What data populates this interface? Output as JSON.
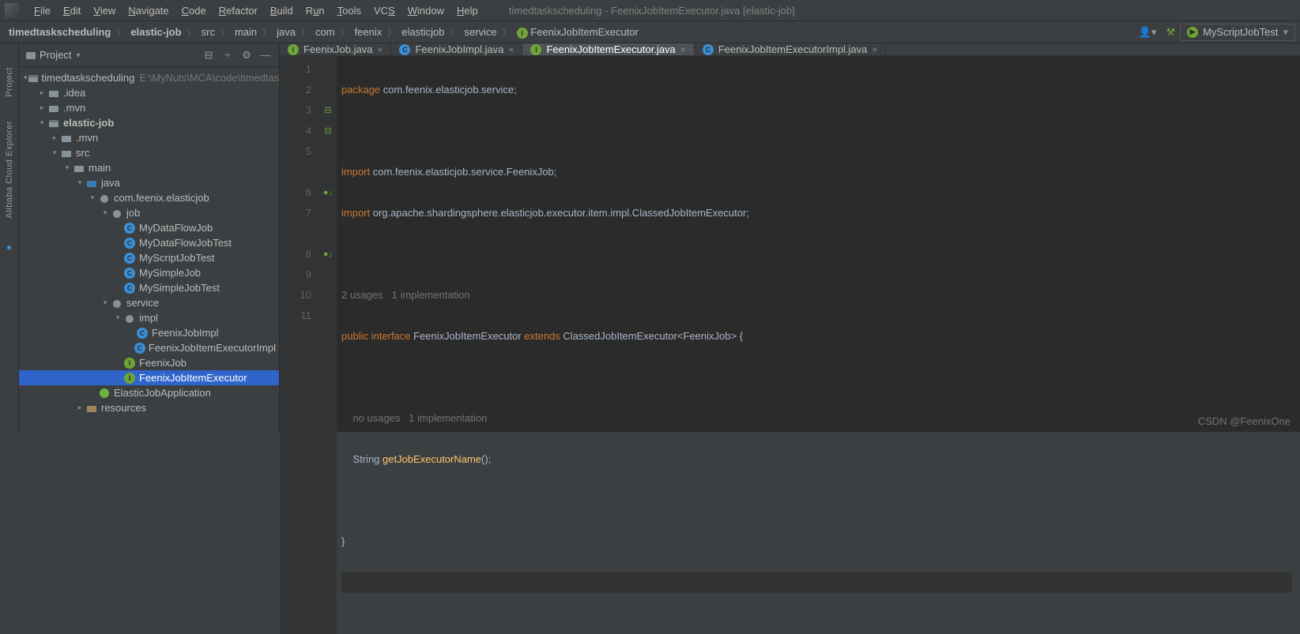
{
  "window": {
    "title": "timedtaskscheduling - FeenixJobItemExecutor.java [elastic-job]"
  },
  "menu": [
    "File",
    "Edit",
    "View",
    "Navigate",
    "Code",
    "Refactor",
    "Build",
    "Run",
    "Tools",
    "VCS",
    "Window",
    "Help"
  ],
  "breadcrumb": [
    {
      "label": "timedtaskscheduling",
      "bold": true
    },
    {
      "label": "elastic-job",
      "bold": true
    },
    {
      "label": "src"
    },
    {
      "label": "main"
    },
    {
      "label": "java"
    },
    {
      "label": "com"
    },
    {
      "label": "feenix"
    },
    {
      "label": "elasticjob"
    },
    {
      "label": "service"
    },
    {
      "label": "FeenixJobItemExecutor",
      "icon": "interface"
    }
  ],
  "run_config": "MyScriptJobTest",
  "left_tools": [
    "Project",
    "Alibaba Cloud Explorer"
  ],
  "project_panel": {
    "title": "Project"
  },
  "tree": [
    {
      "d": 0,
      "a": "open",
      "icon": "module",
      "label": "timedtaskscheduling",
      "dim": "E:\\MyNuts\\MCA\\code\\timedtask"
    },
    {
      "d": 1,
      "a": "closed",
      "icon": "folder",
      "label": ".idea"
    },
    {
      "d": 1,
      "a": "closed",
      "icon": "folder",
      "label": ".mvn"
    },
    {
      "d": 1,
      "a": "open",
      "icon": "module",
      "label": "elastic-job",
      "bold": true
    },
    {
      "d": 2,
      "a": "closed",
      "icon": "folder",
      "label": ".mvn"
    },
    {
      "d": 2,
      "a": "open",
      "icon": "folder",
      "label": "src"
    },
    {
      "d": 3,
      "a": "open",
      "icon": "folder",
      "label": "main"
    },
    {
      "d": 4,
      "a": "open",
      "icon": "source",
      "label": "java"
    },
    {
      "d": 5,
      "a": "open",
      "icon": "package",
      "label": "com.feenix.elasticjob"
    },
    {
      "d": 6,
      "a": "open",
      "icon": "package",
      "label": "job"
    },
    {
      "d": 7,
      "a": "",
      "icon": "class",
      "label": "MyDataFlowJob"
    },
    {
      "d": 7,
      "a": "",
      "icon": "class",
      "label": "MyDataFlowJobTest"
    },
    {
      "d": 7,
      "a": "",
      "icon": "class",
      "label": "MyScriptJobTest"
    },
    {
      "d": 7,
      "a": "",
      "icon": "class",
      "label": "MySimpleJob"
    },
    {
      "d": 7,
      "a": "",
      "icon": "class",
      "label": "MySimpleJobTest"
    },
    {
      "d": 6,
      "a": "open",
      "icon": "package",
      "label": "service"
    },
    {
      "d": 7,
      "a": "open",
      "icon": "package",
      "label": "impl"
    },
    {
      "d": 8,
      "a": "",
      "icon": "class",
      "label": "FeenixJobImpl"
    },
    {
      "d": 8,
      "a": "",
      "icon": "class",
      "label": "FeenixJobItemExecutorImpl"
    },
    {
      "d": 7,
      "a": "",
      "icon": "interface",
      "label": "FeenixJob"
    },
    {
      "d": 7,
      "a": "",
      "icon": "interface",
      "label": "FeenixJobItemExecutor",
      "selected": true
    },
    {
      "d": 5,
      "a": "",
      "icon": "spring",
      "label": "ElasticJobApplication"
    },
    {
      "d": 4,
      "a": "closed",
      "icon": "resources",
      "label": "resources"
    }
  ],
  "tabs": [
    {
      "label": "FeenixJob.java",
      "icon": "interface"
    },
    {
      "label": "FeenixJobImpl.java",
      "icon": "class"
    },
    {
      "label": "FeenixJobItemExecutor.java",
      "icon": "interface",
      "active": true
    },
    {
      "label": "FeenixJobItemExecutorImpl.java",
      "icon": "class"
    }
  ],
  "code": {
    "lines": [
      "1",
      "2",
      "3",
      "4",
      "5",
      "",
      "6",
      "7",
      "",
      "8",
      "9",
      "10",
      "11"
    ],
    "hint1": "2 usages   1 implementation",
    "hint2": "no usages   1 implementation",
    "l1_kw": "package",
    "l1_rest": " com.feenix.elasticjob.service;",
    "l3_kw": "import",
    "l3_rest": " com.feenix.elasticjob.service.FeenixJob;",
    "l4_kw": "import",
    "l4_rest": " org.apache.shardingsphere.elasticjob.executor.item.impl.ClassedJobItemExecutor;",
    "l6_a": "public interface ",
    "l6_b": "FeenixJobItemExecutor ",
    "l6_c": "extends ",
    "l6_d": "ClassedJobItemExecutor<FeenixJob> {",
    "l8_a": "    String ",
    "l8_b": "getJobExecutorName",
    "l8_c": "();",
    "l10": "}"
  },
  "watermark": "CSDN @FeenixOne"
}
